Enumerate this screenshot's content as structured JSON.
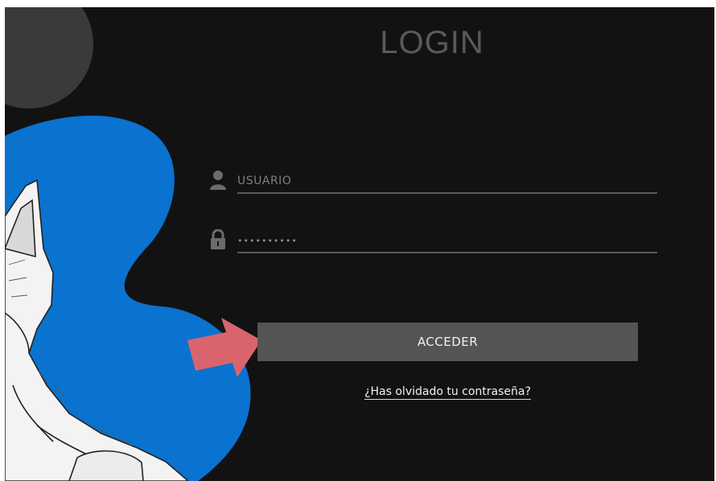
{
  "title": "LOGIN",
  "username": {
    "placeholder": "USUARIO",
    "icon": "user-icon"
  },
  "password": {
    "value": "••••••••••",
    "icon": "lock-icon"
  },
  "submit": {
    "label": "ACCEDER"
  },
  "forgot_password": {
    "label": "¿Has olvidado tu contraseña?"
  },
  "colors": {
    "background": "#121212",
    "blob": "#0a72cf",
    "button": "#545454",
    "arrow": "#d9646e",
    "title": "#5a5a5a"
  }
}
